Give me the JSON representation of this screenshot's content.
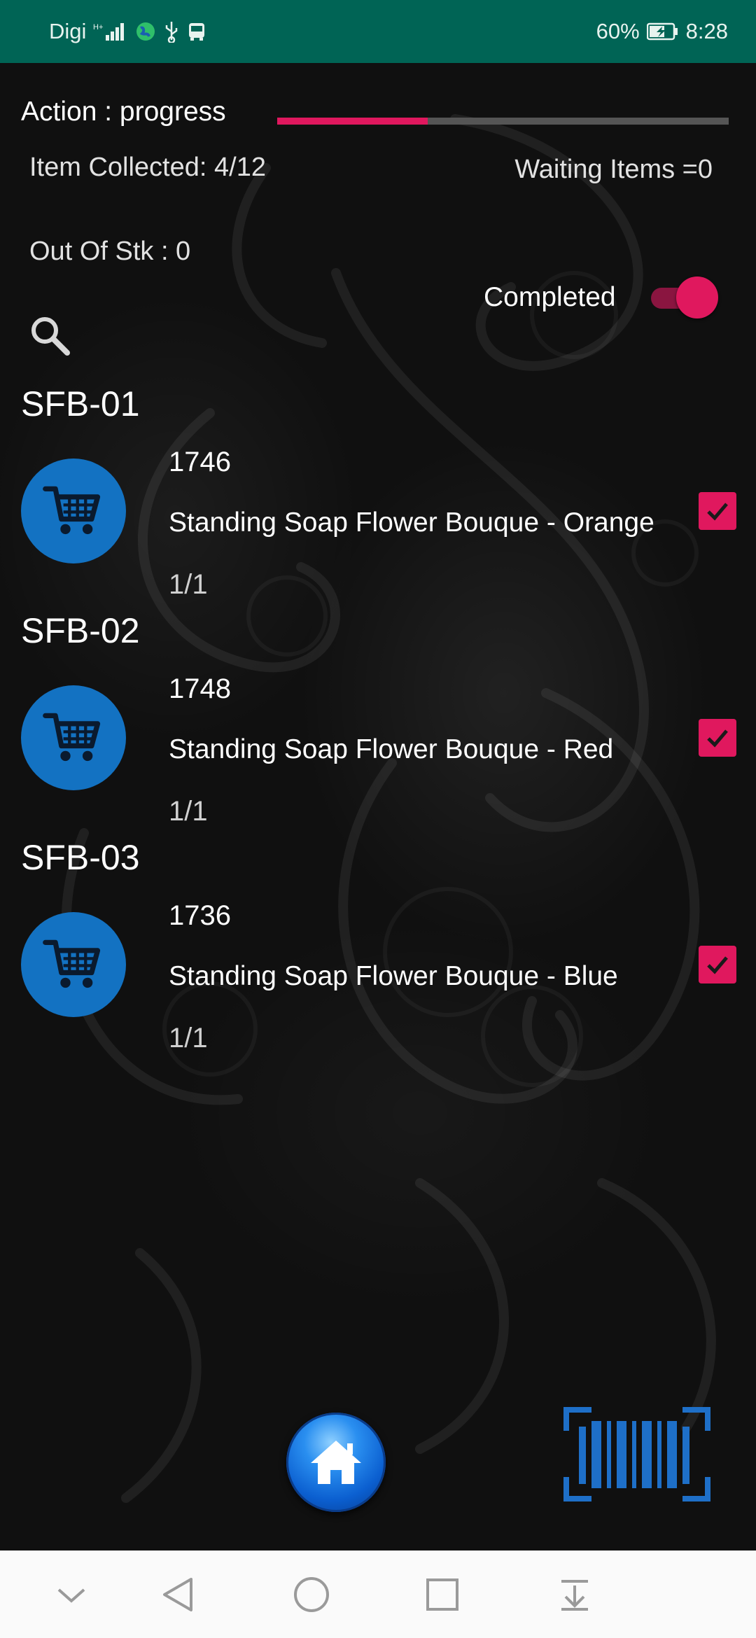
{
  "status_bar": {
    "carrier": "Digi",
    "signal_label": "H+",
    "battery": "60%",
    "time": "8:28"
  },
  "header": {
    "action_text": "Action : progress",
    "progress_fraction": 0.333,
    "item_collected": "Item Collected: 4/12",
    "waiting_items": "Waiting Items =0",
    "out_of_stock": "Out Of Stk : 0",
    "completed_label": "Completed",
    "completed_on": true
  },
  "groups": [
    {
      "title": "SFB-01",
      "code": "1746",
      "name": "Standing Soap Flower Bouque - Orange",
      "qty": "1/1",
      "checked": true
    },
    {
      "title": "SFB-02",
      "code": "1748",
      "name": "Standing Soap Flower Bouque - Red",
      "qty": "1/1",
      "checked": true
    },
    {
      "title": "SFB-03",
      "code": "1736",
      "name": "Standing Soap Flower Bouque - Blue",
      "qty": "1/1",
      "checked": true
    }
  ],
  "colors": {
    "status_bar": "#006455",
    "accent": "#e0185e",
    "cart_blue": "#1372c2",
    "barcode_blue": "#1e6fc8"
  },
  "icons": {
    "search": "search-icon",
    "cart": "shopping-cart-icon",
    "home": "home-icon",
    "barcode": "barcode-scan-icon",
    "nav": [
      "chevron-down-icon",
      "back-icon",
      "home-circle-icon",
      "recents-icon",
      "notification-pull-icon"
    ]
  }
}
